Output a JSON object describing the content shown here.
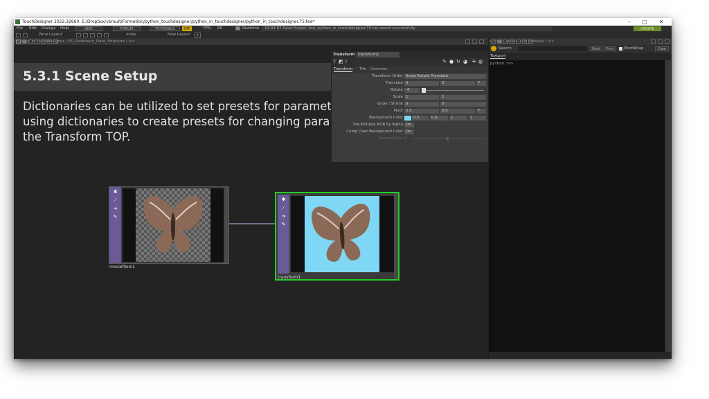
{
  "window": {
    "title": "TouchDesigner 2022.32660: E:/Dropbox/vbrault/Formation/python_touchdesigner/python_in_touchdesigner/python_in_touchdesigner.75.toe*",
    "minimize_glyph": "–",
    "maximize_glyph": "▢",
    "close_glyph": "✕"
  },
  "menubar": {
    "file": "File",
    "edit": "Edit",
    "dialogs": "Dialogs",
    "help": "Help",
    "wiki": "WIKI",
    "forum": "FORUM",
    "tutorials": "TUTORIALS",
    "perform_badge": "OIT",
    "fps_label": "FPS:",
    "fps_value": "60",
    "realtime_label": "Realtime",
    "status": "14:34:07 Save Project .toe: python_in_touchdesigner.75.toe saved successfully.",
    "update": "UPDATE",
    "accent_color": "#c8a400"
  },
  "toolbar": {
    "pane_layout": "Pane Layout",
    "index": "index",
    "new_layout": "New Layout",
    "plus": "+"
  },
  "network_path": {
    "path": "/ python_in_touchdesigner / 05_Dictionary_Data_Structure / >>"
  },
  "textport_path": {
    "path": "<< 02_Classes_and_Modules / >>"
  },
  "slide": {
    "heading": "5.3.1 Scene Setup",
    "lines": [
      "Dictionaries can be utilized to set presets for paramet",
      "using dictionaries to create presets for changing para",
      "the Transform TOP."
    ]
  },
  "nodes": {
    "moviefile": {
      "label": "moviefilein1",
      "icons": [
        "gear-icon",
        "pin-icon",
        "arrow-icon",
        "pencil-icon"
      ]
    },
    "transform": {
      "label": "transform1",
      "bg_color": "#7fd6f5",
      "border_color": "#22cc22"
    }
  },
  "param": {
    "op_type": "Transform",
    "op_name": "transform1",
    "tabs": [
      "Transform",
      "Tile",
      "Common"
    ],
    "rows": [
      {
        "label": "Transform Order",
        "values": [
          "Scale Rotate Translate"
        ]
      },
      {
        "label": "Translate",
        "values": [
          "0",
          "0",
          "F"
        ]
      },
      {
        "label": "Rotate",
        "values": [
          "-4"
        ]
      },
      {
        "label": "Scale",
        "values": [
          "1",
          "1"
        ]
      },
      {
        "label": "Grow / Shrink",
        "values": [
          "0",
          "0"
        ]
      },
      {
        "label": "Pivot",
        "values": [
          "0.5",
          "0.5",
          "F"
        ]
      },
      {
        "label": "Background Color",
        "values": [
          "0.5",
          "0.9",
          "1",
          "1"
        ]
      },
      {
        "label": "Pre-Multiply RGB by Alpha",
        "values": [
          "On"
        ]
      },
      {
        "label": "Comp Over Background Color",
        "values": [
          "On"
        ]
      },
      {
        "label": "Remove Bias",
        "values": [
          "0"
        ]
      }
    ],
    "swatch_color": "#7fd6f5"
  },
  "textport": {
    "search_label": "Search",
    "next": "Next",
    "prev": "Prev",
    "wordwrap": "WordWrap",
    "clear": "Clear",
    "tab": "Textport",
    "prompt": "python >>>"
  }
}
